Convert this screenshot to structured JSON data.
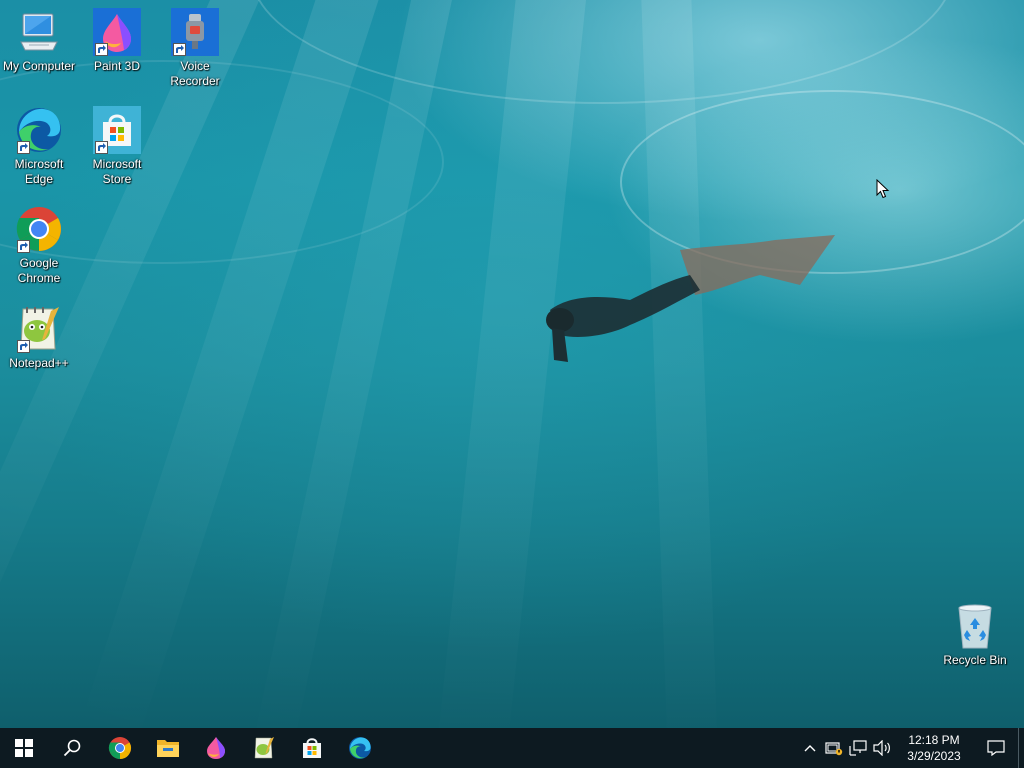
{
  "desktop": {
    "icons": [
      {
        "id": "my-computer",
        "label": "My Computer"
      },
      {
        "id": "paint-3d",
        "label": "Paint 3D"
      },
      {
        "id": "voice-recorder",
        "label": "Voice Recorder"
      },
      {
        "id": "microsoft-edge",
        "label": "Microsoft Edge"
      },
      {
        "id": "microsoft-store",
        "label": "Microsoft Store"
      },
      {
        "id": "google-chrome",
        "label": "Google Chrome"
      },
      {
        "id": "notepad-plus-plus",
        "label": "Notepad++"
      },
      {
        "id": "recycle-bin",
        "label": "Recycle Bin"
      }
    ]
  },
  "taskbar": {
    "pinned": [
      "start-icon",
      "search-icon",
      "chrome-icon",
      "file-explorer-icon",
      "paint-3d-icon",
      "notepad-plus-plus-icon",
      "microsoft-store-icon",
      "edge-icon"
    ],
    "tray": {
      "icons": [
        "chevron-up-icon",
        "security-icon",
        "network-icon",
        "volume-icon"
      ],
      "time": "12:18 PM",
      "date": "3/29/2023"
    }
  },
  "colors": {
    "taskbar": "#0d1a21",
    "water_top": "#1b8fa6",
    "water_bottom": "#0f5f6c"
  }
}
